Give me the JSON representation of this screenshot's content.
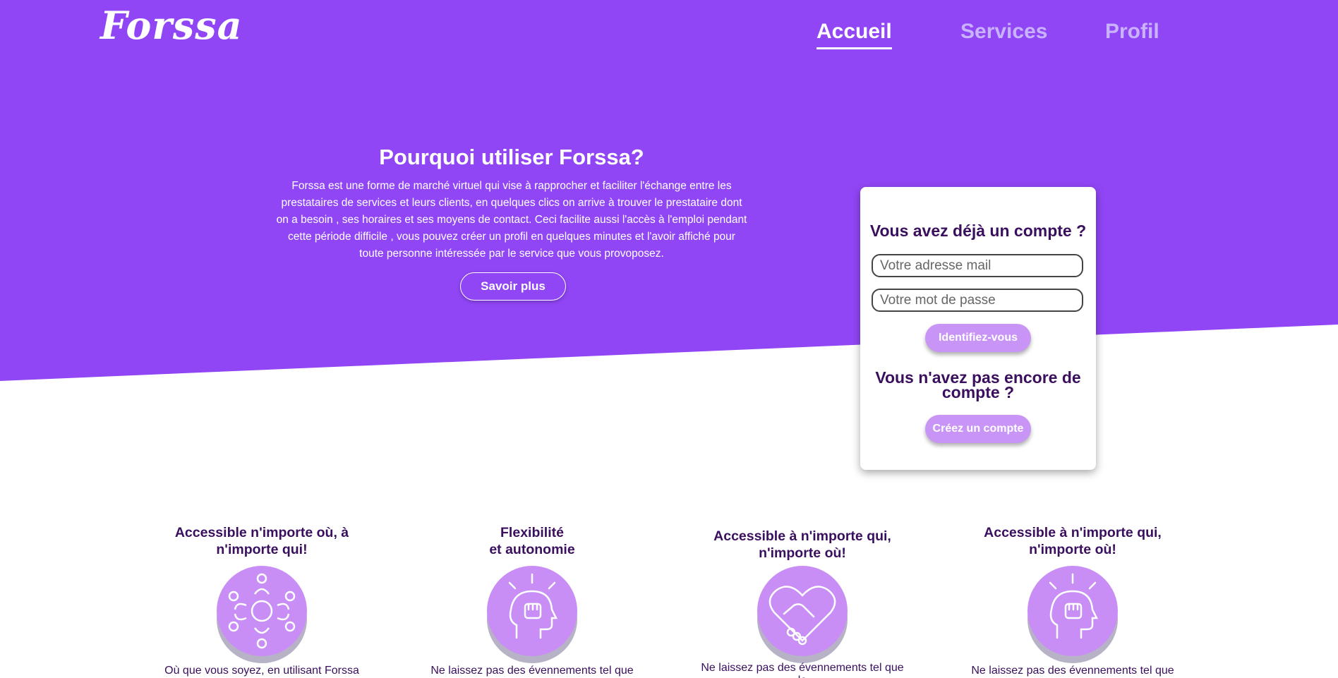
{
  "colors": {
    "hero_purple": "#9146f6",
    "nav_inactive": "#c9b3ff",
    "dark_text": "#3a0f5e",
    "button_light_purple": "#c895f7",
    "icon_circle": "#c88ef5"
  },
  "header": {
    "logo": "Forssa",
    "nav": [
      {
        "label": "Accueil",
        "active": true
      },
      {
        "label": "Services",
        "active": false
      },
      {
        "label": "Profil",
        "active": false
      }
    ]
  },
  "hero": {
    "title": "Pourquoi utiliser Forssa?",
    "text": "Forssa est une forme de marché virtuel qui vise à rapprocher et faciliter l'échange entre les prestataires de services et leurs clients, en quelques clics on arrive à trouver le prestataire dont on a besoin , ses horaires et ses moyens de contact. Ceci facilite aussi l'accès à l'emploi pendant cette période difficile , vous pouvez créer un profil en quelques minutes et l'avoir affiché pour toute personne intéressée par le service que vous provoposez.",
    "button": "Savoir plus"
  },
  "login": {
    "heading": "Vous avez déjà un compte ?",
    "email_placeholder": "Votre adresse mail",
    "password_placeholder": "Votre mot de passe",
    "login_button": "Identifiez-vous",
    "signup_heading_line1": "Vous n'avez pas encore de",
    "signup_heading_line2": "compte ?",
    "signup_button": "Créez un compte"
  },
  "features": [
    {
      "title": "Accessible n'importe où, à\nn'importe qui!",
      "icon": "people-circle-icon",
      "desc": "Où que vous soyez, en utilisant Forssa"
    },
    {
      "title": "Flexibilité\net autonomie",
      "icon": "head-fist-icon",
      "desc": "Ne laissez pas des évennements tel que le"
    },
    {
      "title": "Accessible à n'importe qui,\nn'importe où!",
      "icon": "heart-handshake-icon",
      "desc": "Ne laissez pas des évennements tel que le"
    },
    {
      "title": "Accessible à n'importe qui,\nn'importe où!",
      "icon": "head-fist-icon",
      "desc": "Ne laissez pas des évennements tel que le"
    }
  ]
}
